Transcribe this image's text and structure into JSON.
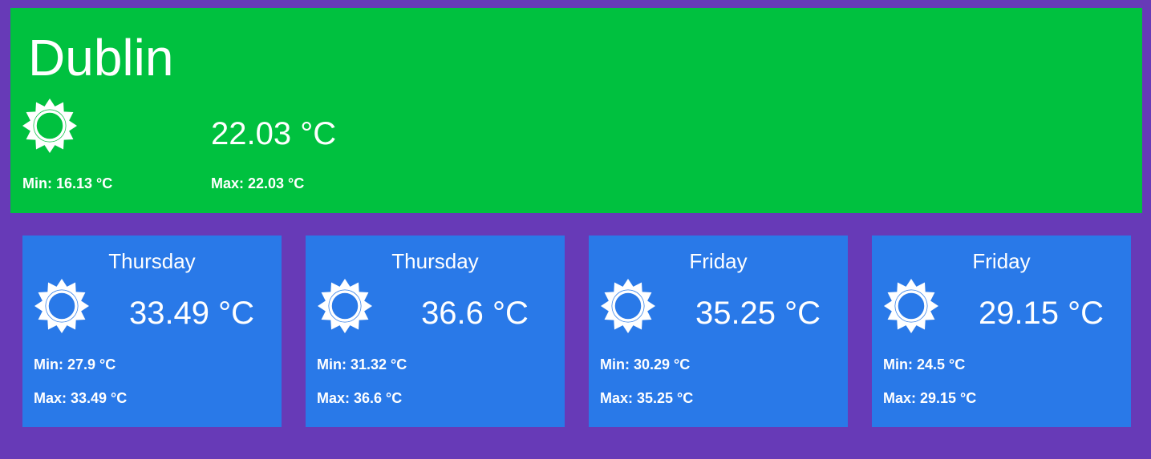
{
  "current": {
    "city": "Dublin",
    "icon": "sun-icon",
    "temp": "22.03 °C",
    "min": "Min: 16.13 °C",
    "max": "Max: 22.03 °C"
  },
  "forecast": [
    {
      "day": "Thursday",
      "icon": "sun-icon",
      "temp": "33.49 °C",
      "min": "Min: 27.9 °C",
      "max": "Max: 33.49 °C"
    },
    {
      "day": "Thursday",
      "icon": "sun-icon",
      "temp": "36.6 °C",
      "min": "Min: 31.32 °C",
      "max": "Max: 36.6 °C"
    },
    {
      "day": "Friday",
      "icon": "sun-icon",
      "temp": "35.25 °C",
      "min": "Min: 30.29 °C",
      "max": "Max: 35.25 °C"
    },
    {
      "day": "Friday",
      "icon": "sun-icon",
      "temp": "29.15 °C",
      "min": "Min: 24.5 °C",
      "max": "Max: 29.15 °C"
    }
  ],
  "colors": {
    "background": "#673ab7",
    "current_card": "#00c13f",
    "forecast_card": "#2979e8",
    "text": "#ffffff"
  }
}
